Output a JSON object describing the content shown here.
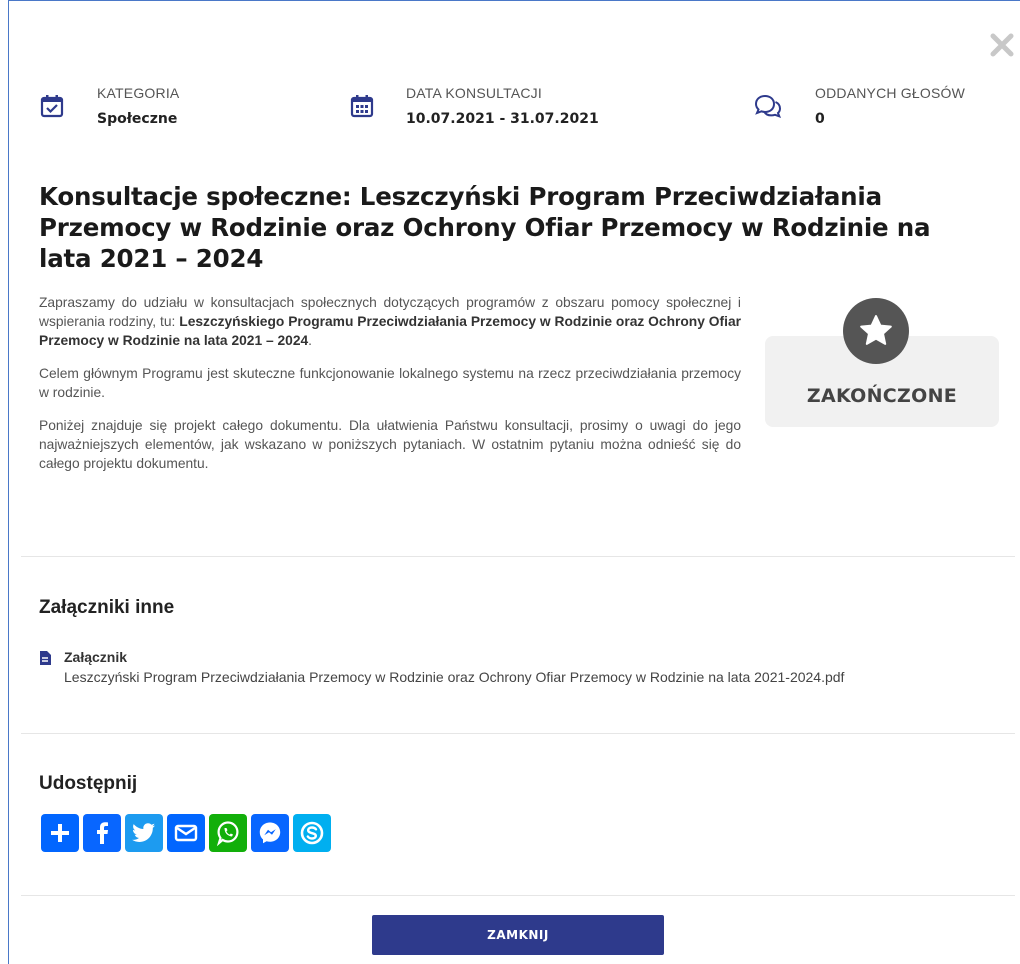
{
  "meta": {
    "category": {
      "label": "KATEGORIA",
      "value": "Społeczne",
      "icon": "calendar-check-icon"
    },
    "date": {
      "label": "DATA KONSULTACJI",
      "value": "10.07.2021 - 31.07.2021",
      "icon": "calendar-icon"
    },
    "votes": {
      "label": "ODDANYCH GŁOSÓW",
      "value": "0",
      "icon": "comments-icon"
    }
  },
  "title": "Konsultacje społeczne: Leszczyński Program Przeciwdziałania Przemocy w Rodzinie oraz Ochrony Ofiar Przemocy w Rodzinie na lata 2021 – 2024",
  "intro": {
    "p1_start": "Zapraszamy do udziału w konsultacjach społecznych dotyczących programów z obszaru pomocy społecznej i wspierania rodziny, tu: ",
    "p1_bold": "Leszczyńskiego Programu Przeciwdziałania Przemocy w Rodzinie oraz Ochrony Ofiar Przemocy w Rodzinie na lata 2021 – 2024",
    "p1_end": ".",
    "p2": "Celem głównym Programu jest skuteczne funkcjonowanie lokalnego systemu na rzecz przeciwdziałania przemocy w rodzinie.",
    "p3": "Poniżej znajduje się projekt całego dokumentu. Dla ułatwienia Państwu konsultacji, prosimy o uwagi do jego najważniejszych elementów, jak wskazano w poniższych pytaniach. W ostatnim pytaniu można odnieść się do całego projektu dokumentu."
  },
  "status": {
    "label": "ZAKOŃCZONE",
    "icon": "star-icon"
  },
  "attachments": {
    "heading": "Załączniki inne",
    "label": "Załącznik",
    "file": "Leszczyński Program Przeciwdziałania Przemocy w Rodzinie oraz Ochrony Ofiar Przemocy w Rodzinie na lata 2021-2024.pdf"
  },
  "share": {
    "heading": "Udostępnij",
    "buttons": [
      {
        "name": "share-add",
        "color": "#0166ff"
      },
      {
        "name": "facebook",
        "color": "#0866ff"
      },
      {
        "name": "twitter",
        "color": "#1d9bf0"
      },
      {
        "name": "email",
        "color": "#0166ff"
      },
      {
        "name": "whatsapp",
        "color": "#12af0a"
      },
      {
        "name": "messenger",
        "color": "#0866ff"
      },
      {
        "name": "skype",
        "color": "#00aff0"
      }
    ]
  },
  "close_button": "ZAMKNIJ",
  "colors": {
    "primary": "#2e3a8c",
    "icon_blue": "#2e3a8c",
    "status_bg": "#f1f1f1"
  }
}
